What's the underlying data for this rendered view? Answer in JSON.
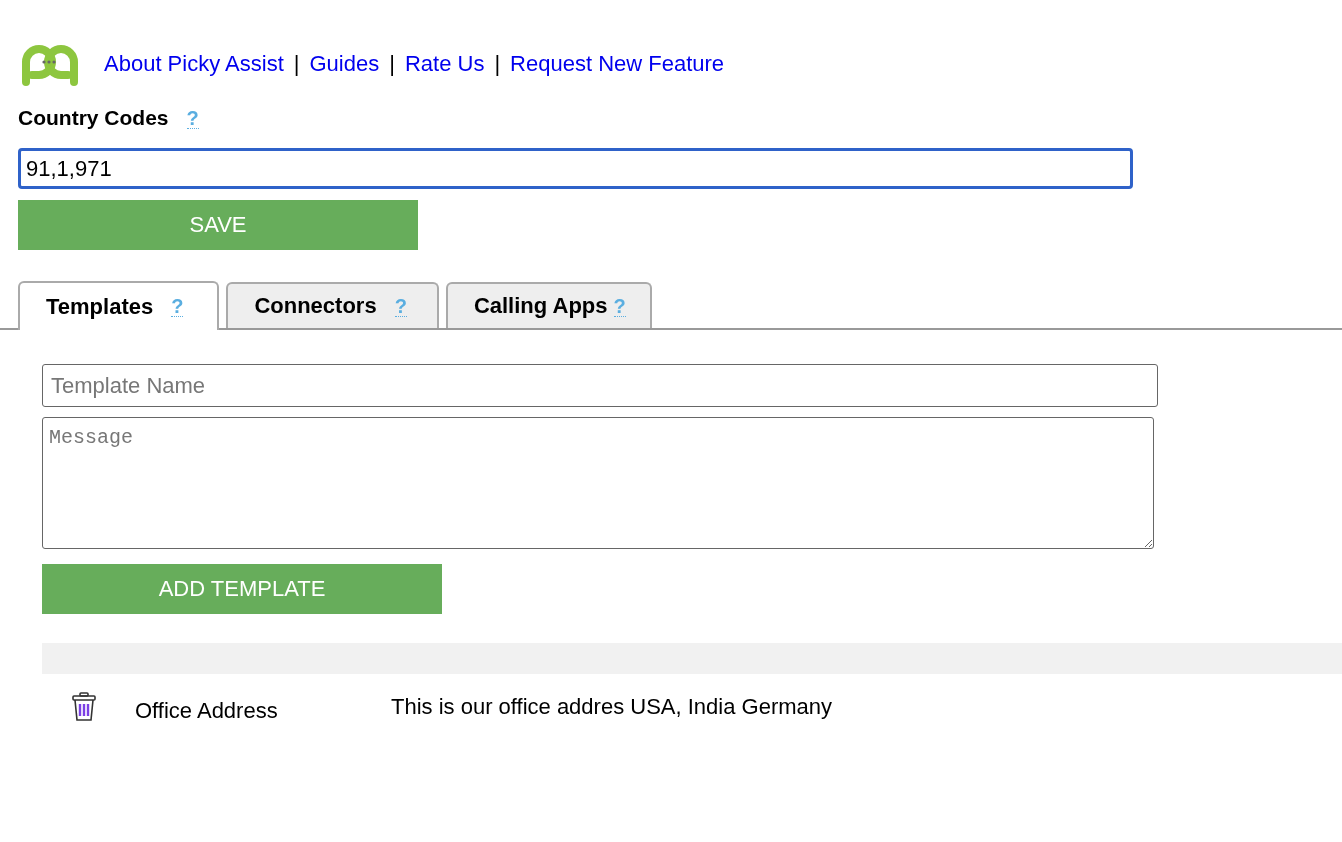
{
  "nav_links": [
    "About Picky Assist",
    "Guides",
    "Rate Us",
    "Request New Feature"
  ],
  "nav_separator": "|",
  "country_codes": {
    "label": "Country Codes",
    "help": "?",
    "value": "91,1,971"
  },
  "save_button": "SAVE",
  "tabs": [
    {
      "label": "Templates",
      "help": "?",
      "selected": true
    },
    {
      "label": "Connectors",
      "help": "?",
      "selected": false
    },
    {
      "label": "Calling Apps",
      "help": "?",
      "selected": false
    }
  ],
  "template_form": {
    "name_placeholder": "Template Name",
    "message_placeholder": "Message",
    "add_button": "ADD TEMPLATE"
  },
  "templates": [
    {
      "name": "Office Address",
      "message": "This is our office addres USA, India Germany"
    }
  ]
}
